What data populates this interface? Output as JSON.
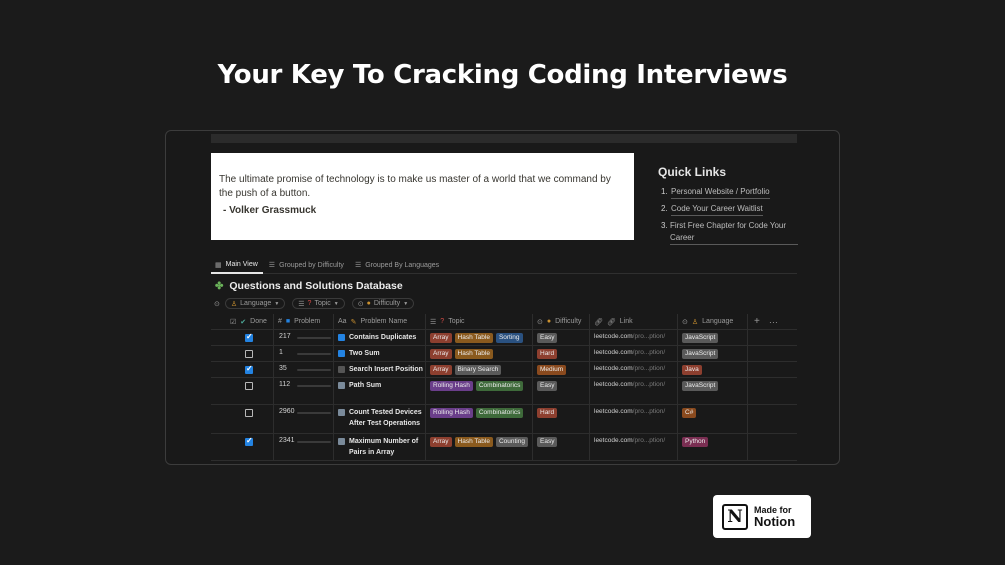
{
  "headline": "Your Key To Cracking Coding Interviews",
  "quote": {
    "text": "The ultimate promise of technology is to make us master of a world that we command by the push of a button.",
    "author": "- Volker Grassmuck"
  },
  "quick_links": {
    "title": "Quick Links",
    "items": [
      {
        "num": "1.",
        "label": "Personal Website / Portfolio"
      },
      {
        "num": "2.",
        "label": "Code Your Career Waitlist"
      },
      {
        "num": "3.",
        "label": "First Free Chapter for Code Your Career"
      }
    ]
  },
  "tabs": [
    {
      "label": "Main View",
      "active": true
    },
    {
      "label": "Grouped by Difficulty",
      "active": false
    },
    {
      "label": "Grouped By Languages",
      "active": false
    }
  ],
  "database": {
    "title": "Questions and Solutions Database",
    "filters": [
      {
        "label": "Language"
      },
      {
        "label": "Topic"
      },
      {
        "label": "Difficulty"
      }
    ],
    "columns": {
      "done": "Done",
      "problem": "Problem",
      "problem_name": "Problem Name",
      "topic": "Topic",
      "difficulty": "Difficulty",
      "link": "Link",
      "language": "Language"
    },
    "rows": [
      {
        "done": true,
        "problem": "217",
        "progress": 0.03,
        "name": "Contains Duplicates",
        "name_icon_color": "#2383e2",
        "topics": [
          {
            "label": "Array",
            "color": "#8d3f2f"
          },
          {
            "label": "Hash Table",
            "color": "#8a5a1e"
          },
          {
            "label": "Sorting",
            "color": "#2a5180"
          }
        ],
        "difficulty": {
          "label": "Easy",
          "color": "#5a5a5a"
        },
        "link": "leetcode.com",
        "link_dim": "/pro...ption/",
        "language": {
          "label": "JavaScript",
          "color": "#5a5a5a"
        }
      },
      {
        "done": false,
        "problem": "1",
        "progress": 0.0,
        "name": "Two Sum",
        "name_icon_color": "#2383e2",
        "topics": [
          {
            "label": "Array",
            "color": "#8d3f2f"
          },
          {
            "label": "Hash Table",
            "color": "#8a5a1e"
          }
        ],
        "difficulty": {
          "label": "Hard",
          "color": "#8d3f2f"
        },
        "link": "leetcode.com",
        "link_dim": "/pro...ption/",
        "language": {
          "label": "JavaScript",
          "color": "#5a5a5a"
        }
      },
      {
        "done": true,
        "problem": "35",
        "progress": 0.01,
        "name": "Search Insert Position",
        "name_icon_color": "#555555",
        "topics": [
          {
            "label": "Array",
            "color": "#8d3f2f"
          },
          {
            "label": "Binary Search",
            "color": "#5a5a5a"
          }
        ],
        "difficulty": {
          "label": "Medium",
          "color": "#8a4a1e"
        },
        "link": "leetcode.com",
        "link_dim": "/pro...ption/",
        "language": {
          "label": "Java",
          "color": "#8d3f2f"
        }
      },
      {
        "done": false,
        "problem": "112",
        "progress": 0.02,
        "name": "Path Sum",
        "name_icon_color": "#7a8a9a",
        "topics": [
          {
            "label": "Rolling Hash",
            "color": "#6a3e8a"
          },
          {
            "label": "Combinatorics",
            "color": "#3e6a3a"
          }
        ],
        "difficulty": {
          "label": "Easy",
          "color": "#5a5a5a"
        },
        "link": "leetcode.com",
        "link_dim": "/pro...ption/",
        "language": {
          "label": "JavaScript",
          "color": "#5a5a5a"
        }
      },
      {
        "done": false,
        "problem": "2960",
        "progress": 0.95,
        "name": "Count Tested Devices After Test Operations",
        "name_icon_color": "#7a8a9a",
        "topics": [
          {
            "label": "Rolling Hash",
            "color": "#6a3e8a"
          },
          {
            "label": "Combinatorics",
            "color": "#3e6a3a"
          }
        ],
        "difficulty": {
          "label": "Hard",
          "color": "#8d3f2f"
        },
        "link": "leetcode.com",
        "link_dim": "/pro...ption/",
        "language": {
          "label": "C#",
          "color": "#8a4a1e"
        }
      },
      {
        "done": true,
        "problem": "2341",
        "progress": 0.8,
        "name": "Maximum Number of Pairs in Array",
        "name_icon_color": "#7a8a9a",
        "topics": [
          {
            "label": "Array",
            "color": "#8d3f2f"
          },
          {
            "label": "Hash Table",
            "color": "#8a5a1e"
          },
          {
            "label": "Counting",
            "color": "#5a5a5a"
          }
        ],
        "difficulty": {
          "label": "Easy",
          "color": "#5a5a5a"
        },
        "link": "leetcode.com",
        "link_dim": "/pro...ption/",
        "language": {
          "label": "Python",
          "color": "#7a2e52"
        }
      }
    ]
  },
  "badge": {
    "line1": "Made for",
    "line2": "Notion",
    "logo": "N"
  }
}
